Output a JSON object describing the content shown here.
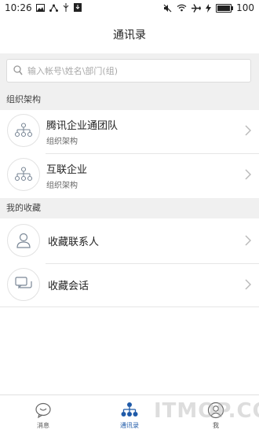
{
  "status_bar": {
    "time": "10:26",
    "battery": "100",
    "battery_level": 1.0
  },
  "header": {
    "title": "通讯录"
  },
  "search": {
    "placeholder": "输入帐号\\姓名\\部门(组)"
  },
  "sections": {
    "org": {
      "label": "组织架构"
    },
    "favorites": {
      "label": "我的收藏"
    }
  },
  "org_items": [
    {
      "title": "腾讯企业通团队",
      "subtitle": "组织架构"
    },
    {
      "title": "互联企业",
      "subtitle": "组织架构"
    }
  ],
  "favorite_items": [
    {
      "title": "收藏联系人"
    },
    {
      "title": "收藏会话"
    }
  ],
  "tabs": [
    {
      "label": "消息",
      "icon": "chat-icon"
    },
    {
      "label": "通讯录",
      "icon": "org-chart-icon"
    },
    {
      "label": "我",
      "icon": "person-icon"
    }
  ],
  "colors": {
    "accent": "#1f5aa8",
    "section_bg": "#f0f0f0"
  },
  "watermark": "ITMOP.COM"
}
